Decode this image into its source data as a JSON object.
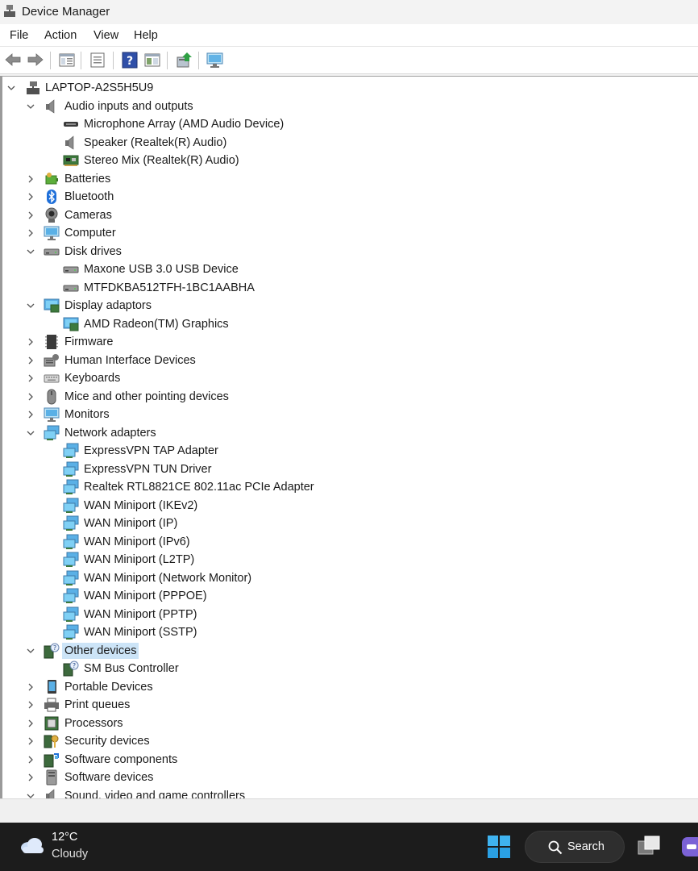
{
  "window": {
    "title": "Device Manager"
  },
  "menu": [
    "File",
    "Action",
    "View",
    "Help"
  ],
  "toolbar": {
    "buttons": [
      "back-icon",
      "forward-icon",
      "properties-pane-icon",
      "list-view-icon",
      "help-icon",
      "action-view-icon",
      "update-driver-icon",
      "scan-hardware-icon"
    ]
  },
  "tree": {
    "root": "LAPTOP-A2S5H5U9",
    "nodes": [
      {
        "label": "Audio inputs and outputs",
        "expanded": true,
        "icon": "speaker-icon",
        "children": [
          {
            "label": "Microphone Array (AMD Audio Device)",
            "icon": "microphone-icon"
          },
          {
            "label": "Speaker (Realtek(R) Audio)",
            "icon": "speaker-icon"
          },
          {
            "label": "Stereo Mix (Realtek(R) Audio)",
            "icon": "sound-card-icon"
          }
        ]
      },
      {
        "label": "Batteries",
        "expanded": false,
        "icon": "battery-icon"
      },
      {
        "label": "Bluetooth",
        "expanded": false,
        "icon": "bluetooth-icon"
      },
      {
        "label": "Cameras",
        "expanded": false,
        "icon": "camera-icon"
      },
      {
        "label": "Computer",
        "expanded": false,
        "icon": "monitor-icon"
      },
      {
        "label": "Disk drives",
        "expanded": true,
        "icon": "disk-icon",
        "children": [
          {
            "label": "Maxone USB 3.0 USB Device",
            "icon": "disk-icon"
          },
          {
            "label": "MTFDKBA512TFH-1BC1AABHA",
            "icon": "disk-icon"
          }
        ]
      },
      {
        "label": "Display adaptors",
        "expanded": true,
        "icon": "display-adapter-icon",
        "children": [
          {
            "label": "AMD Radeon(TM) Graphics",
            "icon": "display-adapter-icon"
          }
        ]
      },
      {
        "label": "Firmware",
        "expanded": false,
        "icon": "chip-icon"
      },
      {
        "label": "Human Interface Devices",
        "expanded": false,
        "icon": "hid-icon"
      },
      {
        "label": "Keyboards",
        "expanded": false,
        "icon": "keyboard-icon"
      },
      {
        "label": "Mice and other pointing devices",
        "expanded": false,
        "icon": "mouse-icon"
      },
      {
        "label": "Monitors",
        "expanded": false,
        "icon": "monitor-icon"
      },
      {
        "label": "Network adapters",
        "expanded": true,
        "icon": "network-icon",
        "children": [
          {
            "label": "ExpressVPN TAP Adapter",
            "icon": "network-icon"
          },
          {
            "label": "ExpressVPN TUN Driver",
            "icon": "network-icon"
          },
          {
            "label": "Realtek RTL8821CE 802.11ac PCIe Adapter",
            "icon": "network-icon"
          },
          {
            "label": "WAN Miniport (IKEv2)",
            "icon": "network-icon"
          },
          {
            "label": "WAN Miniport (IP)",
            "icon": "network-icon"
          },
          {
            "label": "WAN Miniport (IPv6)",
            "icon": "network-icon"
          },
          {
            "label": "WAN Miniport (L2TP)",
            "icon": "network-icon"
          },
          {
            "label": "WAN Miniport (Network Monitor)",
            "icon": "network-icon"
          },
          {
            "label": "WAN Miniport (PPPOE)",
            "icon": "network-icon"
          },
          {
            "label": "WAN Miniport (PPTP)",
            "icon": "network-icon"
          },
          {
            "label": "WAN Miniport (SSTP)",
            "icon": "network-icon"
          }
        ]
      },
      {
        "label": "Other devices",
        "expanded": true,
        "selected": true,
        "icon": "unknown-device-icon",
        "children": [
          {
            "label": "SM Bus Controller",
            "icon": "unknown-device-icon"
          }
        ]
      },
      {
        "label": "Portable Devices",
        "expanded": false,
        "icon": "portable-device-icon"
      },
      {
        "label": "Print queues",
        "expanded": false,
        "icon": "printer-icon"
      },
      {
        "label": "Processors",
        "expanded": false,
        "icon": "processor-icon"
      },
      {
        "label": "Security devices",
        "expanded": false,
        "icon": "security-key-icon"
      },
      {
        "label": "Software components",
        "expanded": false,
        "icon": "software-component-icon"
      },
      {
        "label": "Software devices",
        "expanded": false,
        "icon": "software-device-icon"
      },
      {
        "label": "Sound, video and game controllers",
        "expanded": true,
        "icon": "speaker-icon"
      }
    ]
  },
  "taskbar": {
    "weather": {
      "temp": "12°C",
      "desc": "Cloudy"
    },
    "search_label": "Search"
  }
}
